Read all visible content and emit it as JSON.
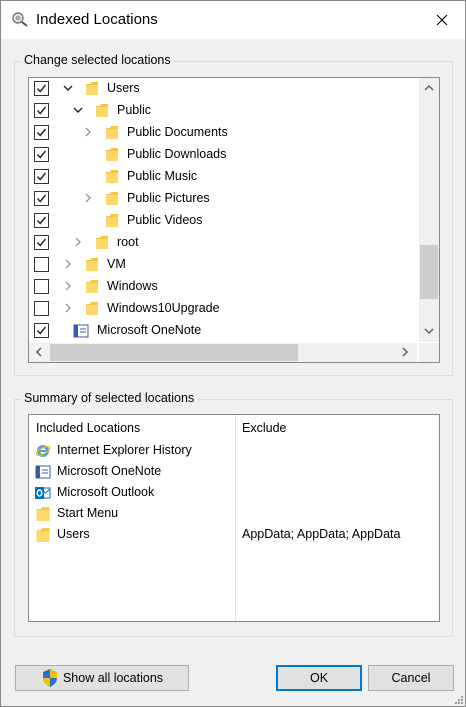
{
  "window": {
    "title": "Indexed Locations"
  },
  "locations": {
    "group_label": "Change selected locations",
    "rows": [
      {
        "label": "Users",
        "checked": true,
        "expander": "expanded",
        "level": 0,
        "icon": "folder-icon"
      },
      {
        "label": "Public",
        "checked": true,
        "expander": "expanded",
        "level": 1,
        "icon": "folder-icon"
      },
      {
        "label": "Public Documents",
        "checked": true,
        "expander": "collapsed",
        "level": 2,
        "icon": "folder-icon"
      },
      {
        "label": "Public Downloads",
        "checked": true,
        "expander": "none",
        "level": 2,
        "icon": "folder-icon"
      },
      {
        "label": "Public Music",
        "checked": true,
        "expander": "none",
        "level": 2,
        "icon": "folder-icon"
      },
      {
        "label": "Public Pictures",
        "checked": true,
        "expander": "collapsed",
        "level": 2,
        "icon": "folder-icon"
      },
      {
        "label": "Public Videos",
        "checked": true,
        "expander": "none",
        "level": 2,
        "icon": "folder-icon"
      },
      {
        "label": "root",
        "checked": true,
        "expander": "collapsed",
        "level": 1,
        "icon": "folder-icon"
      },
      {
        "label": "VM",
        "checked": false,
        "expander": "collapsed",
        "level": 0,
        "icon": "folder-icon"
      },
      {
        "label": "Windows",
        "checked": false,
        "expander": "collapsed",
        "level": 0,
        "icon": "folder-icon"
      },
      {
        "label": "Windows10Upgrade",
        "checked": false,
        "expander": "collapsed",
        "level": 0,
        "icon": "folder-icon"
      },
      {
        "label": "Microsoft OneNote",
        "checked": true,
        "expander": "none",
        "level": -1,
        "icon": "onenote-icon"
      }
    ]
  },
  "summary": {
    "group_label": "Summary of selected locations",
    "col_included": "Included Locations",
    "col_exclude": "Exclude",
    "rows": [
      {
        "label": "Internet Explorer History",
        "exclude": "",
        "icon": "ie-icon"
      },
      {
        "label": "Microsoft OneNote",
        "exclude": "",
        "icon": "onenote-icon"
      },
      {
        "label": "Microsoft Outlook",
        "exclude": "",
        "icon": "outlook-icon"
      },
      {
        "label": "Start Menu",
        "exclude": "",
        "icon": "folder-icon"
      },
      {
        "label": "Users",
        "exclude": "AppData; AppData; AppData",
        "icon": "folder-icon"
      }
    ]
  },
  "buttons": {
    "show_all": "Show all locations",
    "ok": "OK",
    "cancel": "Cancel"
  },
  "colors": {
    "folder": "#f6c343",
    "accent": "#0078d7"
  }
}
